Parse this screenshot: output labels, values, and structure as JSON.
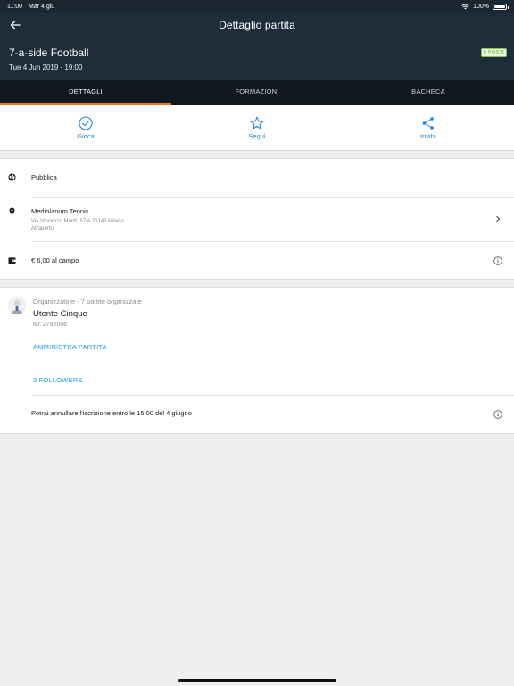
{
  "status_bar": {
    "time": "11:00",
    "date": "Mar 4 giu",
    "battery": "100%",
    "battery_level": 1.0
  },
  "header": {
    "nav_title": "Dettaglio partita",
    "match_title": "7-a-side Football",
    "match_datetime": "Tue 4 Jun 2019 - 19:00",
    "spots_badge": "9 POSTI"
  },
  "tabs": [
    {
      "label": "DETTAGLI",
      "active": true
    },
    {
      "label": "FORMAZIONI",
      "active": false
    },
    {
      "label": "BACHECA",
      "active": false
    }
  ],
  "actions": [
    {
      "label": "Gioca",
      "icon": "check-circle-icon"
    },
    {
      "label": "Segui",
      "icon": "star-icon"
    },
    {
      "label": "Invita",
      "icon": "share-icon"
    }
  ],
  "info": {
    "visibility": "Pubblica",
    "venue_name": "Mediolanum Tennis",
    "venue_address": "Via Vincenzo Monti, 57 A 20145 Milano",
    "venue_type": "All'aperto",
    "price": "€ 6,00 al campo"
  },
  "organizer": {
    "role": "Organizzatore - 7 partite organizzate",
    "name": "Utente Cinque",
    "id": "ID: 2792056",
    "manage_label": "AMMINISTRA PARTITA",
    "followers_label": "3 FOLLOWERS",
    "cancel_notice": "Potrai annullare l'iscrizione entro le 15:00 del 4 giugno"
  },
  "colors": {
    "header_bg": "#1f2d3a",
    "tab_bg": "#0f171f",
    "tab_indicator": "#f0792b",
    "accent_blue": "#1e88d8",
    "badge_green": "#7ec85a"
  }
}
